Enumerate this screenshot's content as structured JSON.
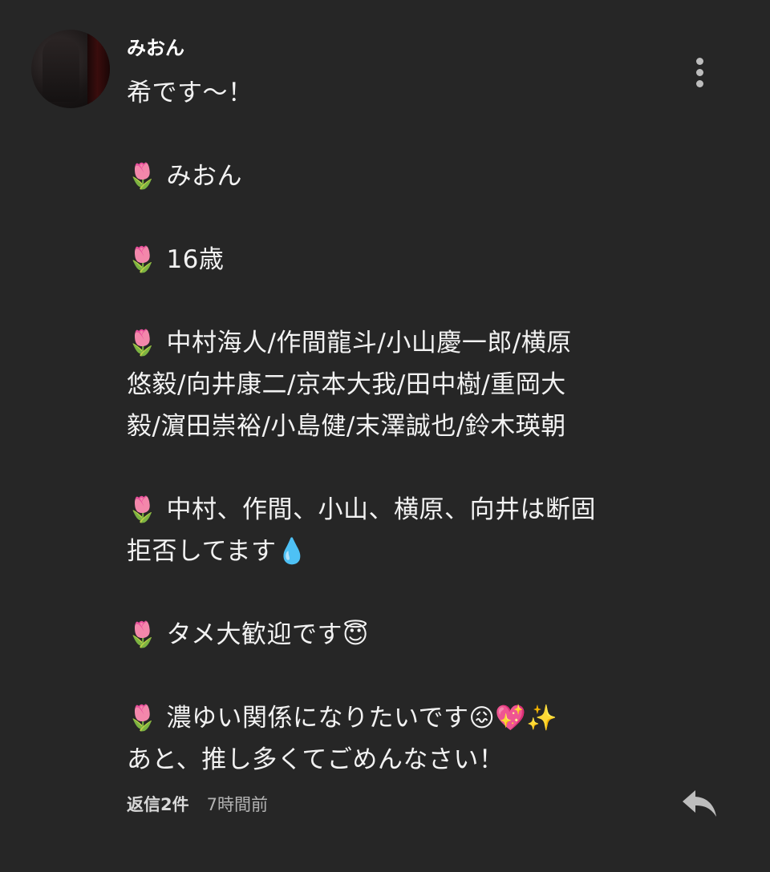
{
  "comment": {
    "username": "みおん",
    "body_lines": [
      "希です〜！",
      "",
      "🌷 みおん",
      "",
      "🌷 16歳",
      "",
      "🌷 中村海人/作間龍斗/小山慶一郎/横原",
      "悠毅/向井康二/京本大我/田中樹/重岡大",
      "毅/濵田崇裕/小島健/末澤誠也/鈴木瑛朝",
      "",
      "🌷 中村、作間、小山、横原、向井は断固",
      "拒否してます💧",
      "",
      "🌷 タメ大歓迎です😇",
      "",
      "🌷 濃ゆい関係になりたいです😖💖✨",
      "あと、推し多くてごめんなさい！"
    ],
    "replies_label": "返信2件",
    "timestamp": "7時間前"
  },
  "icons": {
    "more": "more-vertical-icon",
    "reply": "reply-arrow-icon"
  },
  "colors": {
    "background": "#262626",
    "text_primary": "#ffffff",
    "text_secondary": "#b3b3b3",
    "icon": "#bdbdbd"
  }
}
